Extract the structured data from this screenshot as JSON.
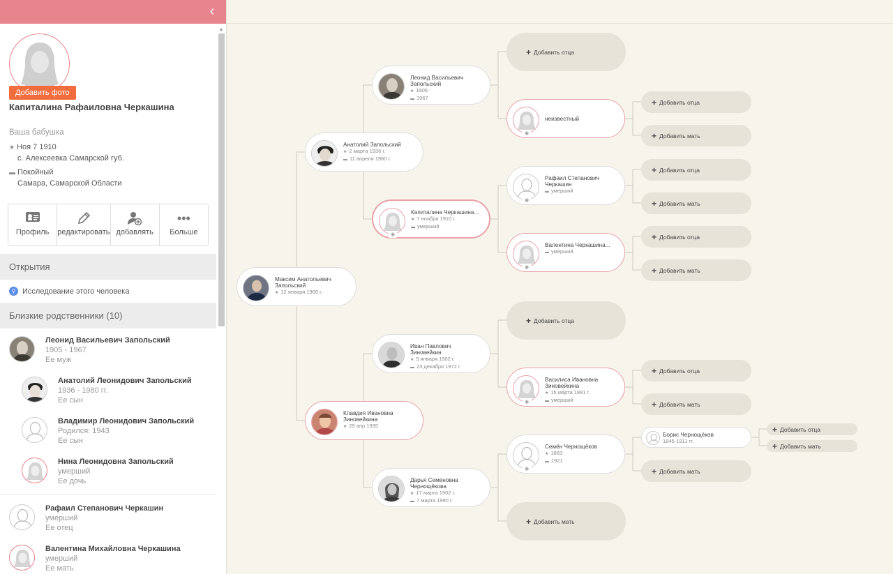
{
  "sidebar": {
    "collapse_icon": "chevron-left-icon",
    "add_photo": "Добавить фото",
    "name": "Капиталина Рафаиловна Черкашина",
    "relation": "Ваша бабушка",
    "birth_date": "Ноя 7 1910",
    "birth_place": "с. Алексеевка Самарской губ.",
    "death_label": "Покойный",
    "death_place": "Самара, Самарской Области",
    "actions": [
      {
        "label": "Профиль",
        "icon": "profile-card-icon"
      },
      {
        "label": "редактировать",
        "icon": "pencil-icon"
      },
      {
        "label": "добавлять",
        "icon": "add-person-icon"
      },
      {
        "label": "Больше",
        "icon": "more-dots-icon"
      }
    ],
    "discoveries_title": "Открытия",
    "research_link": "Исследование этого человека",
    "close_relatives_title": "Близкие родственники (10)",
    "relatives": [
      {
        "name": "Леонид Васильевич Запольский",
        "line1": "1905 - 1967",
        "line2": "Ее муж"
      },
      {
        "name": "Анатолий Леонидович Запольский",
        "line1": "1936 - 1980 гг.",
        "line2": "Ее сын"
      },
      {
        "name": "Владимир Леонидович Запольский",
        "line1": "Родился: 1943",
        "line2": "Ее сын"
      },
      {
        "name": "Нина Леонидовна Запольский",
        "line1": "умерший",
        "line2": "Ее дочь"
      },
      {
        "name": "Рафаил Степанович Черкашин",
        "line1": "умерший",
        "line2": "Ее отец"
      },
      {
        "name": "Валентина Михайловна Черкашина",
        "line1": "умерший",
        "line2": "Ее мать"
      }
    ]
  },
  "tree": {
    "root": {
      "name": "Максим Анатольевич Запольский",
      "birth": "12 января 1966 г."
    },
    "anatoly": {
      "name": "Анатолий Запольский",
      "birth": "2 марта 1936 г.",
      "death": "11 апреля 1980 г."
    },
    "leonid": {
      "name": "Леонид Васильевич Запольский",
      "birth": "1905",
      "death": "1967"
    },
    "unknown": {
      "name": "неизвестный"
    },
    "kapitalina": {
      "name": "Капиталина Черкашина...",
      "birth": "7 ноября 1910 г.",
      "death": "умерший"
    },
    "rafail": {
      "name": "Рафаил Степанович Черкашин",
      "death": "умерший"
    },
    "valentina": {
      "name": "Валентина Черкашина...",
      "death": "умерший"
    },
    "klavdia": {
      "name": "Клавдия Ивановна Зиновейкина",
      "birth": "29 апр 1935"
    },
    "ivan": {
      "name": "Иван Павлович Зиновейкин",
      "birth": "5 января 1902 г.",
      "death": "23 декабря 1972 г."
    },
    "vasilisa": {
      "name": "Василиса Ивановна Зиновейкина",
      "birth": "15 марта 1881 г.",
      "death": "умерший"
    },
    "darya": {
      "name": "Дарья Семеновна Чернощёкова",
      "birth": "17 марта 1902 г.",
      "death": "7 марта 1990 г."
    },
    "semyon": {
      "name": "Семён Чернощёков",
      "birth": "1863",
      "death": "1921"
    },
    "boris": {
      "name": "Борис Чернощёков",
      "life": "1845-1911 гг."
    },
    "add_father": "Добавить отца",
    "add_mother": "Добавить мать"
  },
  "colors": {
    "accent_pink": "#e8848d",
    "add_photo_orange": "#f26d3d",
    "canvas_bg": "#f7f4ec",
    "add_button_bg": "#e6e3d9"
  }
}
